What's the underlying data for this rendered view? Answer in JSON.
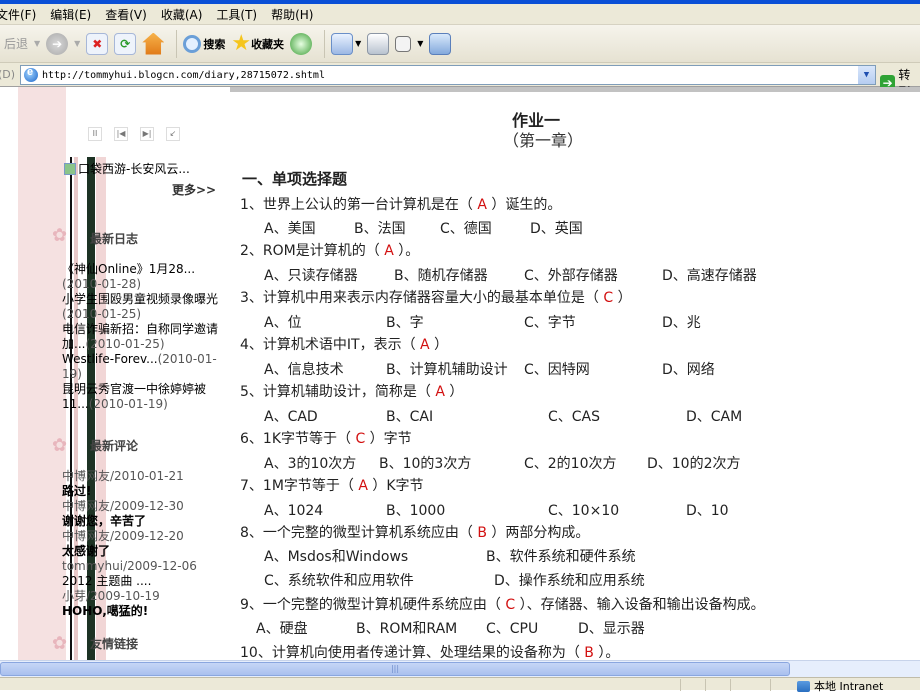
{
  "browser": {
    "menu": [
      "文件(F)",
      "编辑(E)",
      "查看(V)",
      "收藏(A)",
      "工具(T)",
      "帮助(H)"
    ],
    "toolbar": {
      "back_label": "后退",
      "search_label": "搜索",
      "favorites_label": "收藏夹"
    },
    "address": {
      "label": "地址(D)",
      "url": "http://tommyhui.blogcn.com/diary,28715072.shtml",
      "go_label": "转到"
    },
    "status": {
      "zone": "本地 Intranet"
    }
  },
  "sidebar": {
    "music_title": "口袋西游-长安风云...",
    "more_label": "更多>>",
    "recent_posts_title": "最新日志",
    "recent_posts": [
      {
        "title": "《神仙Online》1月28...",
        "date": "(2010-01-28)"
      },
      {
        "title": "小学生围殴男童视频录像曝光",
        "date": "(2010-01-25)"
      },
      {
        "title": "电信诈骗新招：自称同学邀请加...",
        "date": "(2010-01-25)"
      },
      {
        "title": "Westlife-Forev...",
        "date": "(2010-01-19)"
      },
      {
        "title": "昆明云秀官渡一中徐婷婷被11...",
        "date": "(2010-01-19)"
      }
    ],
    "recent_comments_title": "最新评论",
    "recent_comments": [
      {
        "author": "中博网友/2010-01-21",
        "text": "路过!"
      },
      {
        "author": "中博网友/2009-12-30",
        "text": "谢谢您，辛苦了"
      },
      {
        "author": "中博网友/2009-12-20",
        "text": "太感谢了"
      },
      {
        "author": "tommyhui/2009-12-06",
        "text": "2012 主题曲 ...."
      },
      {
        "author": "小芽/2009-10-19",
        "text": "HOHO,噶猛的!"
      }
    ],
    "links_title": "友情链接"
  },
  "article": {
    "title": "作业一",
    "subtitle": "（第一章）",
    "section": "一、单项选择题",
    "questions": [
      {
        "pre": "1、世界上公认的第一台计算机是在（ ",
        "ans": "A",
        "post": " ）诞生的。",
        "options": [
          "A、美国",
          "B、法国",
          "C、德国",
          "D、英国"
        ]
      },
      {
        "pre": "2、ROM是计算机的（ ",
        "ans": "A",
        "post": " ）。",
        "options": [
          "A、只读存储器",
          "B、随机存储器",
          "C、外部存储器",
          "D、高速存储器"
        ]
      },
      {
        "pre": "3、计算机中用来表示内存储器容量大小的最基本单位是（ ",
        "ans": "C",
        "post": " ）",
        "options": [
          "A、位",
          "B、字",
          "C、字节",
          "D、兆"
        ]
      },
      {
        "pre": "4、计算机术语中IT，表示（ ",
        "ans": "A",
        "post": " ）",
        "options": [
          "A、信息技术",
          "B、计算机辅助设计",
          "C、因特网",
          "D、网络"
        ]
      },
      {
        "pre": "5、计算机辅助设计，简称是（ ",
        "ans": "A",
        "post": " ）",
        "options": [
          "A、CAD",
          "B、CAI",
          "C、CAS",
          "D、CAM"
        ]
      },
      {
        "pre": "6、1K字节等于（ ",
        "ans": "C",
        "post": " ）字节",
        "options": [
          "A、3的10次方",
          "B、10的3次方",
          "C、2的10次方",
          "D、10的2次方"
        ]
      },
      {
        "pre": "7、1M字节等于（ ",
        "ans": "A",
        "post": " ）K字节",
        "options": [
          "A、1024",
          "B、1000",
          "C、10×10",
          "D、10"
        ]
      },
      {
        "pre": "8、一个完整的微型计算机系统应由（ ",
        "ans": "B",
        "post": " ）两部分构成。",
        "options": [
          "A、Msdos和Windows",
          "B、软件系统和硬件系统",
          "C、系统软件和应用软件",
          "D、操作系统和应用系统"
        ]
      },
      {
        "pre": "9、一个完整的微型计算机硬件系统应由（ ",
        "ans": "C",
        "post": " ）、存储器、输入设备和输出设备构成。",
        "options": [
          "A、硬盘",
          "B、ROM和RAM",
          "C、CPU",
          "D、显示器"
        ]
      },
      {
        "pre": "10、计算机向使用者传递计算、处理结果的设备称为（ ",
        "ans": "B",
        "post": " ）。",
        "options": []
      }
    ]
  },
  "colors": {
    "answer": "#d21010",
    "titlebar": "#0a4fd6"
  }
}
